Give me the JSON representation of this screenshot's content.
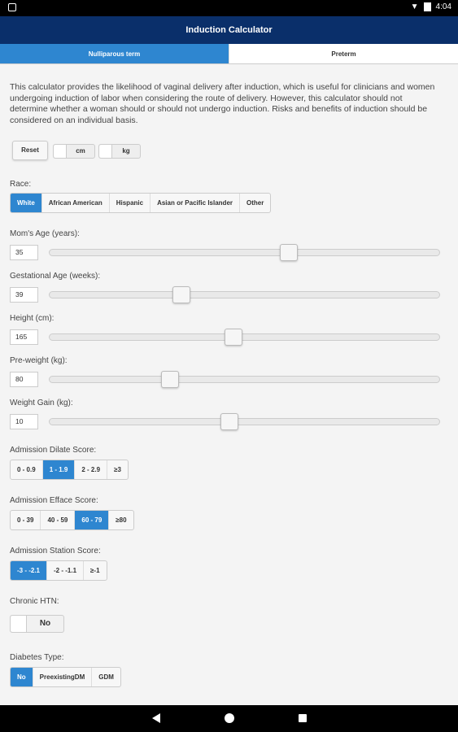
{
  "status_bar": {
    "time": "4:04",
    "icons": [
      "notification-icon",
      "wifi-off-icon",
      "battery-icon"
    ]
  },
  "app_bar": {
    "title": "Induction Calculator"
  },
  "tabs": [
    {
      "label": "Nulliparous term",
      "active": true
    },
    {
      "label": "Preterm",
      "active": false
    }
  ],
  "intro": "This calculator provides the likelihood of vaginal delivery after induction, which is useful for clinicians and women undergoing induction of labor when considering the route of delivery. However, this calculator should not determine whether a woman should or should not undergo induction. Risks and benefits of induction should be considered on an individual basis.",
  "controls": {
    "reset_label": "Reset",
    "cm_label": "cm",
    "kg_label": "kg"
  },
  "race": {
    "label": "Race:",
    "options": [
      "White",
      "African American",
      "Hispanic",
      "Asian or Pacific Islander",
      "Other"
    ],
    "selected": "White"
  },
  "sliders": {
    "age": {
      "label": "Mom's Age (years):",
      "value": "35",
      "fraction": 0.62
    },
    "gestational": {
      "label": "Gestational Age (weeks):",
      "value": "39",
      "fraction": 0.33
    },
    "height": {
      "label": "Height (cm):",
      "value": "165",
      "fraction": 0.47
    },
    "preweight": {
      "label": "Pre-weight (kg):",
      "value": "80",
      "fraction": 0.3
    },
    "weight_gain": {
      "label": "Weight Gain (kg):",
      "value": "10",
      "fraction": 0.46
    }
  },
  "dilate": {
    "label": "Admission Dilate Score:",
    "options": [
      "0 - 0.9",
      "1 - 1.9",
      "2 - 2.9",
      "≥3"
    ],
    "selected": "1 - 1.9"
  },
  "efface": {
    "label": "Admission Efface Score:",
    "options": [
      "0 - 39",
      "40 - 59",
      "60 - 79",
      "≥80"
    ],
    "selected": "60 - 79"
  },
  "station": {
    "label": "Admission Station Score:",
    "options": [
      "-3 - -2.1",
      "-2 - -1.1",
      "≥-1"
    ],
    "selected": "-3 - -2.1"
  },
  "htn": {
    "label": "Chronic HTN:",
    "value": "No"
  },
  "diabetes": {
    "label": "Diabetes Type:",
    "options": [
      "No",
      "PreexistingDM",
      "GDM"
    ],
    "selected": "No"
  },
  "colors": {
    "app_bar": "#0a2f6a",
    "accent": "#2e86d0"
  }
}
